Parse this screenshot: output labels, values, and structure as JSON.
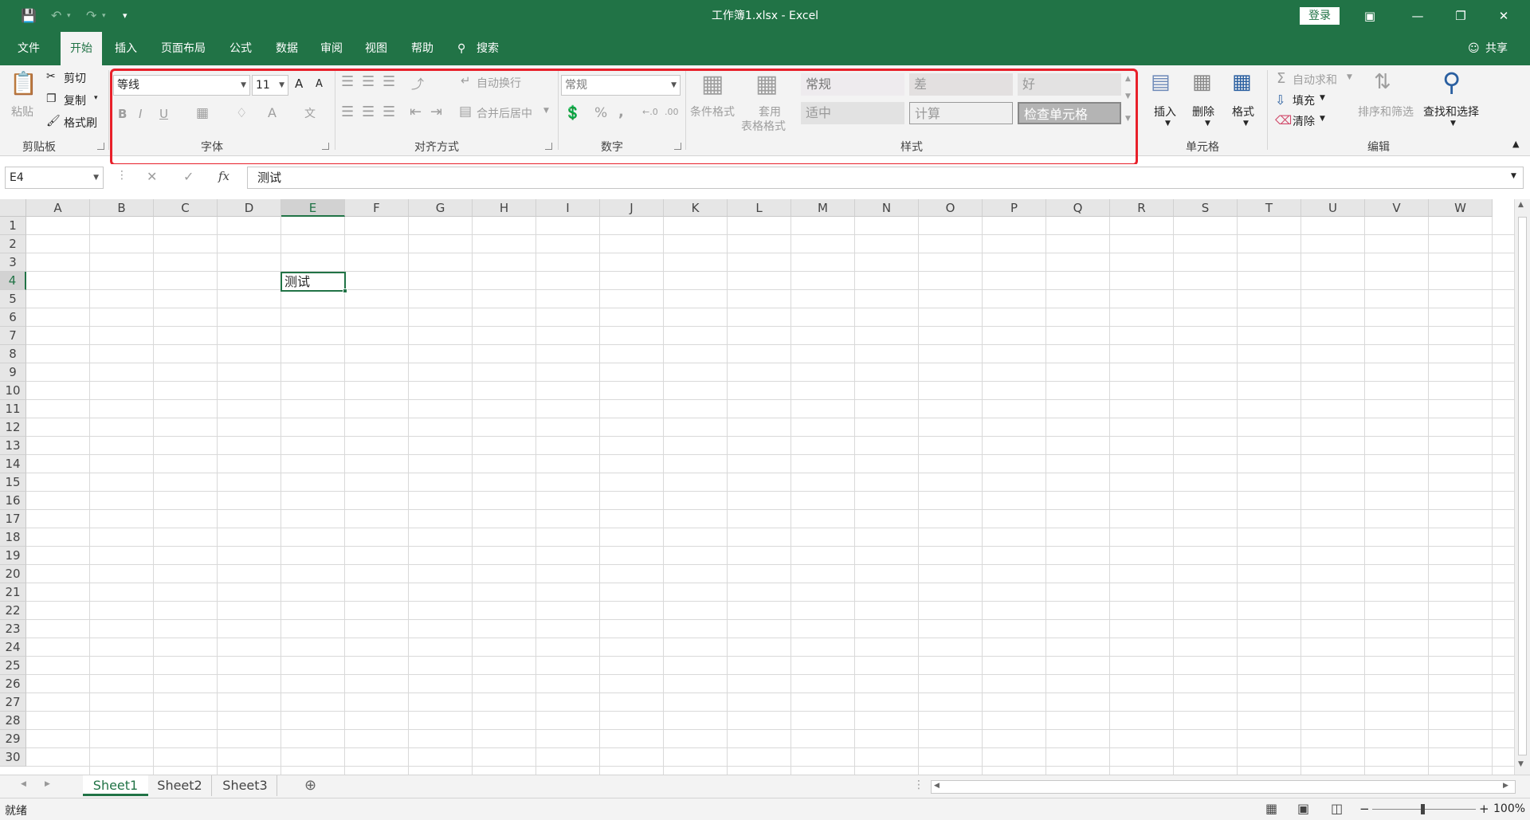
{
  "titlebar": {
    "title": "工作簿1.xlsx  -  Excel",
    "login_label": "登录",
    "qat": {
      "customize": "▾"
    }
  },
  "tabs": [
    "文件",
    "开始",
    "插入",
    "页面布局",
    "公式",
    "数据",
    "审阅",
    "视图",
    "帮助",
    "搜索"
  ],
  "share_label": "共享",
  "clipboard": {
    "paste": "粘贴",
    "cut": "剪切",
    "copy": "复制",
    "format_painter": "格式刷",
    "group": "剪贴板"
  },
  "font": {
    "name": "等线",
    "size": "11",
    "grow": "A",
    "shrink": "A",
    "bold": "B",
    "italic": "I",
    "underline": "U",
    "color_a": "A",
    "phonetic": "文",
    "group": "字体"
  },
  "alignment": {
    "wrap": "自动换行",
    "merge": "合并后居中",
    "group": "对齐方式"
  },
  "number": {
    "format": "常规",
    "percent": "%",
    "comma": ",",
    "inc_dec": ".00",
    "group": "数字"
  },
  "styles": {
    "conditional": "条件格式",
    "table_1": "套用",
    "table_2": "表格格式",
    "normal": "常规",
    "bad": "差",
    "good": "好",
    "neutral": "适中",
    "calculation": "计算",
    "check_cell": "检查单元格",
    "group": "样式"
  },
  "cells": {
    "insert": "插入",
    "delete": "删除",
    "format": "格式",
    "group": "单元格"
  },
  "editing": {
    "autosum": "自动求和",
    "fill": "填充",
    "clear": "清除",
    "sort_filter": "排序和筛选",
    "find_select": "查找和选择",
    "group": "编辑"
  },
  "formula_bar": {
    "name_box": "E4",
    "cancel": "✕",
    "enter": "✓",
    "fx": "fx",
    "content": "测试"
  },
  "grid": {
    "columns": [
      "A",
      "B",
      "C",
      "D",
      "E",
      "F",
      "G",
      "H",
      "I",
      "J",
      "K",
      "L",
      "M",
      "N",
      "O",
      "P",
      "Q",
      "R",
      "S",
      "T",
      "U",
      "V",
      "W"
    ],
    "rows": [
      "1",
      "2",
      "3",
      "4",
      "5",
      "6",
      "7",
      "8",
      "9",
      "10",
      "11",
      "12",
      "13",
      "14",
      "15",
      "16",
      "17",
      "18",
      "19",
      "20",
      "21",
      "22",
      "23",
      "24",
      "25",
      "26",
      "27",
      "28",
      "29",
      "30"
    ],
    "active_cell": {
      "ref": "E4",
      "value": "测试"
    }
  },
  "sheets": [
    "Sheet1",
    "Sheet2",
    "Sheet3"
  ],
  "status": {
    "ready": "就绪",
    "zoom": "100%",
    "minus": "−",
    "plus": "+"
  },
  "colors": {
    "brand": "#217346",
    "highlight": "#e8202a"
  }
}
